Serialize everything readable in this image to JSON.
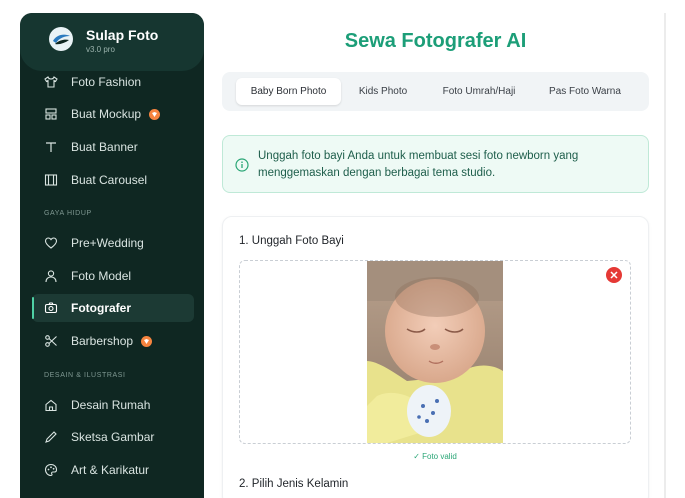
{
  "brand": {
    "name": "Sulap Foto",
    "version": "v3.0 pro"
  },
  "sidebar": {
    "items_top": [
      {
        "label": "Foto Fashion",
        "icon": "shirt-icon"
      },
      {
        "label": "Buat Mockup",
        "icon": "mockup-icon",
        "badge": true
      },
      {
        "label": "Buat Banner",
        "icon": "text-icon"
      },
      {
        "label": "Buat Carousel",
        "icon": "carousel-icon"
      }
    ],
    "section_lifestyle": "GAYA HIDUP",
    "items_lifestyle": [
      {
        "label": "Pre+Wedding",
        "icon": "heart-icon"
      },
      {
        "label": "Foto Model",
        "icon": "person-icon"
      },
      {
        "label": "Fotografer",
        "icon": "camera-icon",
        "active": true
      },
      {
        "label": "Barbershop",
        "icon": "scissors-icon",
        "badge": true
      }
    ],
    "section_design": "DESAIN & ILUSTRASI",
    "items_design": [
      {
        "label": "Desain Rumah",
        "icon": "home-icon"
      },
      {
        "label": "Sketsa Gambar",
        "icon": "pen-icon"
      },
      {
        "label": "Art & Karikatur",
        "icon": "palette-icon"
      }
    ]
  },
  "main": {
    "title": "Sewa Fotografer AI",
    "tabs": [
      "Baby Born Photo",
      "Kids Photo",
      "Foto Umrah/Haji",
      "Pas Foto Warna"
    ],
    "active_tab": "Baby Born Photo",
    "info_text": "Unggah foto bayi Anda untuk membuat sesi foto newborn yang menggemaskan dengan berbagai tema studio.",
    "step1_label": "1. Unggah Foto Bayi",
    "valid_text": "✓ Foto valid",
    "step2_label": "2. Pilih Jenis Kelamin"
  },
  "colors": {
    "accent": "#1c9e78",
    "sidebar_bg": "#0f2722",
    "badge": "#f6843f",
    "remove": "#e53935"
  }
}
